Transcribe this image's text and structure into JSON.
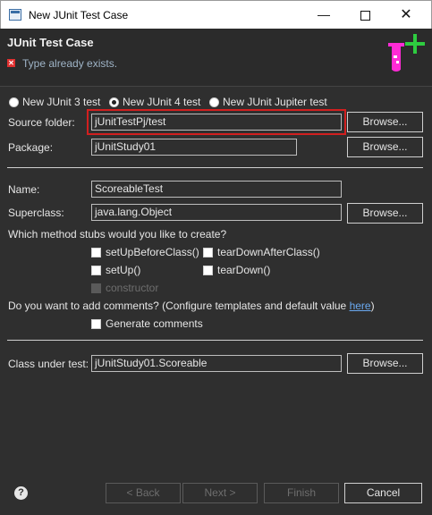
{
  "window": {
    "title": "New JUnit Test Case",
    "controls": {
      "minimize": "—",
      "maximize": "",
      "close": "✕"
    }
  },
  "header": {
    "title": "JUnit Test Case",
    "error_icon": "✕",
    "message": "Type already exists.",
    "wizard_icon": "junit-test-tube-icon",
    "wizard_icon_colors": {
      "tube": "#ff2bd6",
      "plus": "#2ecc40"
    }
  },
  "version_options": [
    {
      "label": "New JUnit 3 test",
      "selected": false
    },
    {
      "label": "New JUnit 4 test",
      "selected": true
    },
    {
      "label": "New JUnit Jupiter test",
      "selected": false
    }
  ],
  "source_folder": {
    "label": "Source folder:",
    "value": "jUnitTestPj/test",
    "browse": "Browse..."
  },
  "package": {
    "label": "Package:",
    "value": "jUnitStudy01",
    "browse": "Browse..."
  },
  "name": {
    "label": "Name:",
    "value": "ScoreableTest"
  },
  "superclass": {
    "label": "Superclass:",
    "value": "java.lang.Object",
    "browse": "Browse..."
  },
  "stubs": {
    "question": "Which method stubs would you like to create?",
    "options": [
      {
        "label": "setUpBeforeClass()",
        "checked": false,
        "enabled": true
      },
      {
        "label": "tearDownAfterClass()",
        "checked": false,
        "enabled": true
      },
      {
        "label": "setUp()",
        "checked": false,
        "enabled": true
      },
      {
        "label": "tearDown()",
        "checked": false,
        "enabled": true
      },
      {
        "label": "constructor",
        "checked": false,
        "enabled": false
      }
    ]
  },
  "comments": {
    "question_prefix": "Do you want to add comments? (Configure templates and default value ",
    "link": "here",
    "question_suffix": ")",
    "generate_label": "Generate comments",
    "checked": false
  },
  "class_under_test": {
    "label": "Class under test:",
    "value": "jUnitStudy01.Scoreable",
    "browse": "Browse..."
  },
  "footer": {
    "help": "?",
    "back": "< Back",
    "next": "Next >",
    "finish": "Finish",
    "cancel": "Cancel"
  },
  "colors": {
    "highlight": "#d21f1f",
    "background": "#2f2f2f",
    "link": "#6aa9f0"
  }
}
